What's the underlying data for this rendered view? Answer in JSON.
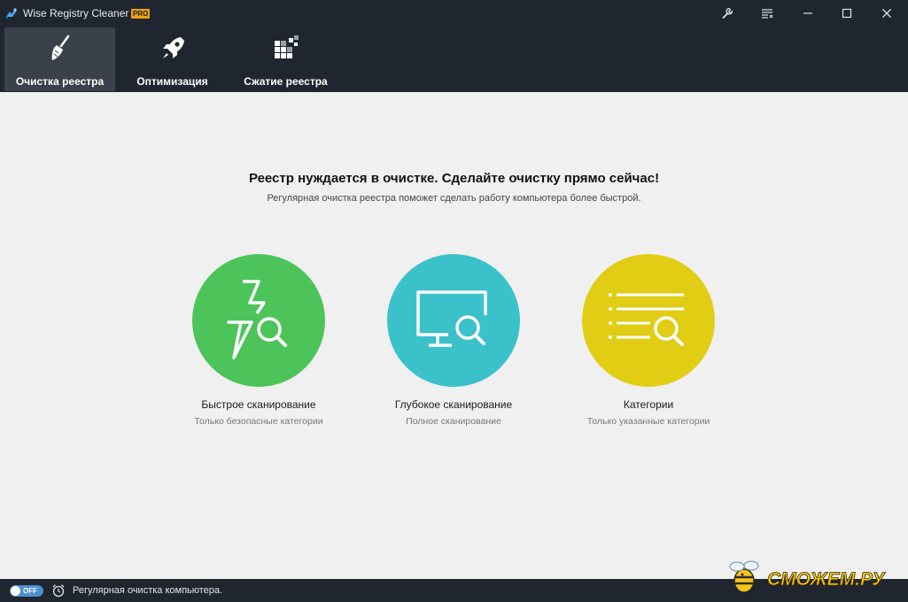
{
  "titlebar": {
    "title": "Wise Registry Cleaner X",
    "badge": "PRO"
  },
  "tabs": [
    {
      "label": "Очистка реестра",
      "icon": "broom-icon",
      "active": true
    },
    {
      "label": "Оптимизация",
      "icon": "rocket-icon",
      "active": false
    },
    {
      "label": "Сжатие реестра",
      "icon": "compress-blocks-icon",
      "active": false
    }
  ],
  "main": {
    "headline": "Реестр нуждается в очистке. Сделайте очистку прямо сейчас!",
    "subline": "Регулярная очистка реестра поможет сделать работу компьютера более быстрой."
  },
  "scan_options": [
    {
      "title": "Быстрое сканирование",
      "subtitle": "Только безопасные категории",
      "color": "#4cc45a",
      "icon": "lightning-search-icon"
    },
    {
      "title": "Глубокое сканирование",
      "subtitle": "Полное сканирование",
      "color": "#3bc1c9",
      "icon": "monitor-search-icon"
    },
    {
      "title": "Категории",
      "subtitle": "Только указанные категории",
      "color": "#e1cd14",
      "icon": "list-search-icon"
    }
  ],
  "statusbar": {
    "toggle": "OFF",
    "text": "Регулярная очистка компьютера."
  },
  "watermark": {
    "text": "СМОЖЕМ.РУ"
  },
  "colors": {
    "chrome": "#20262f",
    "active_tab": "#3a414b",
    "background": "#f0f0f0",
    "toggle": "#4d8fcf",
    "badge": "#e8a21a"
  }
}
